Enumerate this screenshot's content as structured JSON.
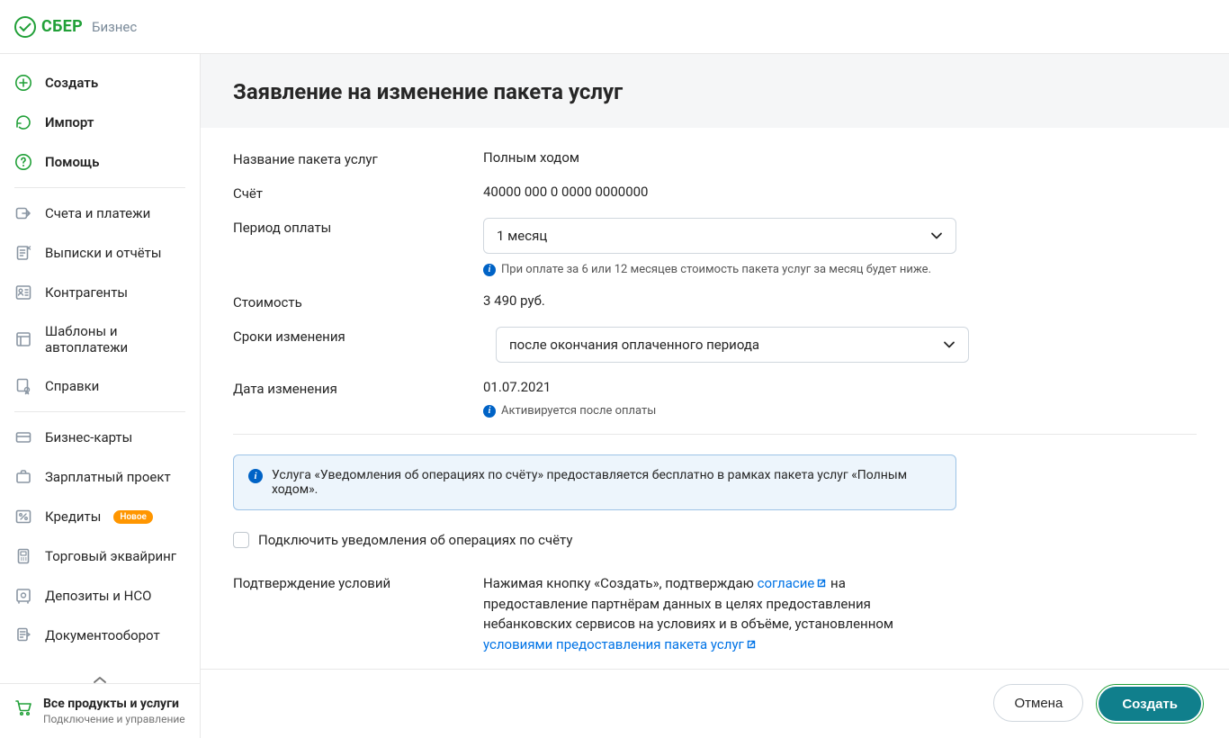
{
  "header": {
    "logo_brand": "СБЕР",
    "logo_sub": "Бизнес"
  },
  "sidebar": {
    "create": "Создать",
    "import": "Импорт",
    "help": "Помощь",
    "accounts": "Счета и платежи",
    "statements": "Выписки и отчёты",
    "counterparties": "Контрагенты",
    "templates": "Шаблоны и автоплатежи",
    "references": "Справки",
    "cards": "Бизнес-карты",
    "payroll": "Зарплатный проект",
    "credits": "Кредиты",
    "credits_badge": "Новое",
    "acquiring": "Торговый эквайринг",
    "deposits": "Депозиты и НСО",
    "docflow": "Документооборот",
    "footer_title": "Все продукты и услуги",
    "footer_sub": "Подключение и управление"
  },
  "main": {
    "title": "Заявление на изменение пакета услуг",
    "labels": {
      "package_name": "Название пакета услуг",
      "account": "Счёт",
      "payment_period": "Период оплаты",
      "cost": "Стоимость",
      "change_terms": "Сроки изменения",
      "change_date": "Дата изменения",
      "confirmation": "Подтверждение условий"
    },
    "values": {
      "package_name": "Полным ходом",
      "account": "40000 000 0 0000 0000000",
      "payment_period": "1 месяц",
      "period_hint": "При оплате за 6 или 12 месяцев стоимость пакета услуг за месяц будет ниже.",
      "cost": "3 490 руб.",
      "change_terms": "после окончания оплаченного периода",
      "change_date": "01.07.2021",
      "date_hint": "Активируется после оплаты"
    },
    "banner": "Услуга «Уведомления об операциях по счёту» предоставляется бесплатно в рамках пакета услуг «Полным ходом».",
    "checkbox_label": "Подключить уведомления об операциях по счёту",
    "confirm": {
      "p1": "Нажимая кнопку «Создать», подтверждаю ",
      "link1": "согласие",
      "p2": "  на предоставление партнёрам данных в целях предоставления небанковских сервисов на условиях и в объёме, установленном ",
      "link2": "условиями предоставления пакета услуг"
    }
  },
  "footer": {
    "cancel": "Отмена",
    "submit": "Создать"
  }
}
